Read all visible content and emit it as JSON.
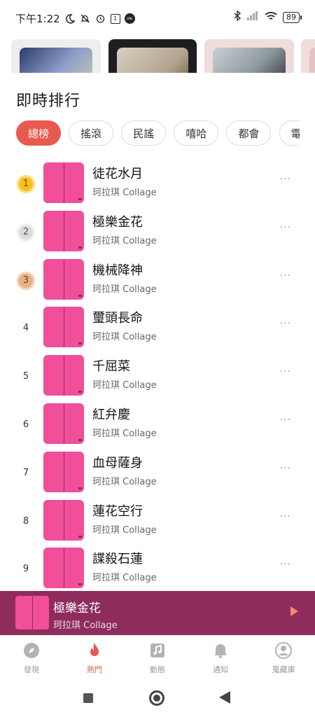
{
  "status": {
    "time": "下午1:22",
    "battery": "89",
    "line_badge": "LINE",
    "calendar": "1"
  },
  "header": {
    "title": "即時排行"
  },
  "chips": [
    {
      "label": "總榜",
      "active": true
    },
    {
      "label": "搖滾",
      "active": false
    },
    {
      "label": "民謠",
      "active": false
    },
    {
      "label": "嘻哈",
      "active": false
    },
    {
      "label": "都會",
      "active": false
    },
    {
      "label": "電",
      "active": false
    }
  ],
  "songs": [
    {
      "rank": "1",
      "title": "徒花水月",
      "artist": "珂拉琪 Collage"
    },
    {
      "rank": "2",
      "title": "極樂金花",
      "artist": "珂拉琪 Collage"
    },
    {
      "rank": "3",
      "title": "機械降神",
      "artist": "珂拉琪 Collage"
    },
    {
      "rank": "4",
      "title": "璽頭長命",
      "artist": "珂拉琪 Collage"
    },
    {
      "rank": "5",
      "title": "千屈菜",
      "artist": "珂拉琪 Collage"
    },
    {
      "rank": "6",
      "title": "紅弁慶",
      "artist": "珂拉琪 Collage"
    },
    {
      "rank": "7",
      "title": "血母薩身",
      "artist": "珂拉琪 Collage"
    },
    {
      "rank": "8",
      "title": "蓮花空行",
      "artist": "珂拉琪 Collage"
    },
    {
      "rank": "9",
      "title": "諜殺石蓮",
      "artist": "珂拉琪 Collage"
    }
  ],
  "more_label": "···",
  "player": {
    "title": "極樂金花",
    "artist": "珂拉琪 Collage"
  },
  "nav": [
    {
      "label": "發現",
      "icon": "compass-icon",
      "active": false
    },
    {
      "label": "熱門",
      "icon": "flame-icon",
      "active": true
    },
    {
      "label": "動態",
      "icon": "music-note-icon",
      "active": false
    },
    {
      "label": "通知",
      "icon": "bell-icon",
      "active": false
    },
    {
      "label": "蒐藏庫",
      "icon": "profile-icon",
      "active": false
    }
  ],
  "colors": {
    "accent": "#e85a4f",
    "cover": "#f14f9a",
    "player_bg": "#8e2c5b"
  }
}
